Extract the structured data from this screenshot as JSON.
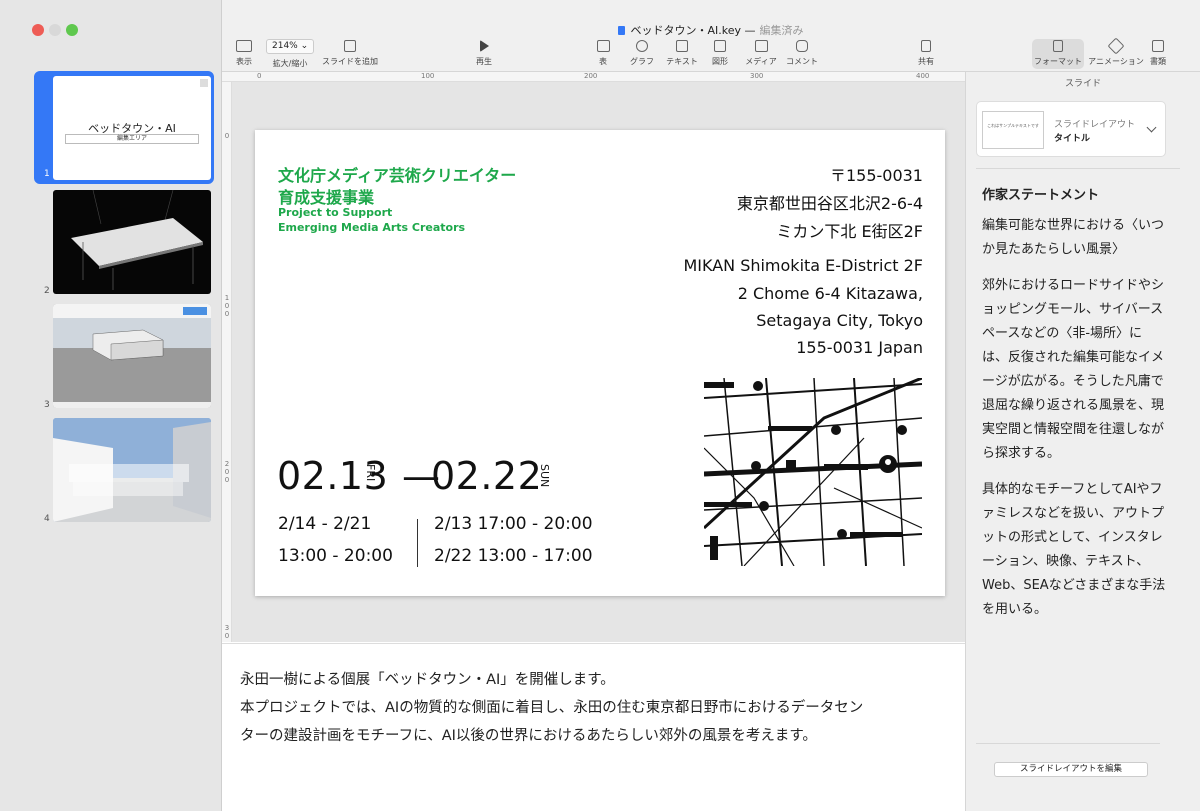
{
  "window": {
    "doc_name": "ベッドタウン・AI.key",
    "separator": "—",
    "edited_label": "編集済み"
  },
  "toolbar": {
    "view": "表示",
    "zoom_value": "214%",
    "zoom_label": "拡大/縮小",
    "add_slide": "スライドを追加",
    "play": "再生",
    "table": "表",
    "chart": "グラフ",
    "text": "テキスト",
    "shape": "図形",
    "media": "メディア",
    "comment": "コメント",
    "share": "共有",
    "format": "フォーマット",
    "animate": "アニメーション",
    "document": "書類"
  },
  "ruler": {
    "top": [
      "0",
      "100",
      "200",
      "300",
      "400"
    ],
    "left": [
      "0",
      "1\n0\n0",
      "2\n0\n0",
      "3\n0"
    ]
  },
  "slides": [
    {
      "num": "1",
      "title": "ベッドタウン・AI",
      "subtitle": "編集エリア",
      "selected": true
    },
    {
      "num": "2"
    },
    {
      "num": "3"
    },
    {
      "num": "4"
    }
  ],
  "slide": {
    "org_ja_1": "文化庁メディア芸術クリエイター",
    "org_ja_2": "育成支援事業",
    "org_en_1": "Project to Support",
    "org_en_2": "Emerging Media Arts Creators",
    "address_ja": [
      "〒155-0031",
      "東京都世田谷区北沢2-6-4",
      "ミカン下北 E街区2F"
    ],
    "address_en": [
      "MIKAN Shimokita E-District 2F",
      "2 Chome 6-4 Kitazawa,",
      "Setagaya City, Tokyo",
      "155-0031 Japan"
    ],
    "date_start": "02.13",
    "day_start": "FRI",
    "date_dash": "—",
    "date_end": "02.22",
    "day_end": "SUN",
    "sched_left": [
      "2/14 - 2/21",
      "13:00 - 20:00"
    ],
    "sched_right": [
      "2/13  17:00 - 20:00",
      "2/22  13:00 - 17:00"
    ],
    "accent_color": "#1ea84b"
  },
  "notes": [
    "永田一樹による個展「ベッドタウン・AI」を開催します。",
    "本プロジェクトでは、AIの物質的な側面に着目し、永田の住む東京都日野市におけるデータセン",
    "ターの建設計画をモチーフに、AI以後の世界におけるあたらしい郊外の風景を考えます。"
  ],
  "inspector": {
    "tab": "スライド",
    "layout_label": "スライドレイアウト",
    "layout_value": "タイトル",
    "layout_thumb_text": "これはサンプルテキストです",
    "statement_title": "作家ステートメント",
    "statement_paras": [
      "編集可能な世界における〈いつか見たあたらしい風景〉",
      "郊外におけるロードサイドやショッピングモール、サイバースペースなどの〈非-場所〉には、反復された編集可能なイメージが広がる。そうした凡庸で退屈な繰り返される風景を、現実空間と情報空間を往還しながら探求する。",
      "具体的なモチーフとしてAIやファミレスなどを扱い、アウトプットの形式として、インスタレーション、映像、テキスト、Web、SEAなどさまざまな手法を用いる。"
    ],
    "edit_layout_button": "スライドレイアウトを編集"
  },
  "colors": {
    "selection": "#3478f6",
    "close": "#ee5c55",
    "maximize": "#5fc84e"
  }
}
